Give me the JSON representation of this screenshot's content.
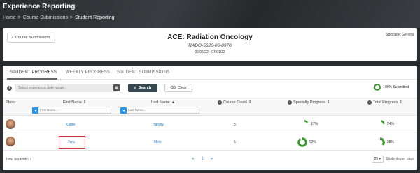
{
  "app": {
    "title": "Experience Reporting",
    "breadcrumb": [
      "Home",
      ">",
      "Course Submissions",
      ">",
      "Student Reporting"
    ]
  },
  "header": {
    "back_label": "Course Submissions",
    "title": "ACE: Radiation Oncology",
    "code": "RADO-5620-06-0970",
    "dates": "06/06/22 - 07/01/22",
    "specialty": "Specialty: General"
  },
  "tabs": [
    {
      "label": "STUDENT PROGRESS",
      "active": true
    },
    {
      "label": "WEEKLY PROGRESS",
      "active": false
    },
    {
      "label": "STUDENT SUBMISSIONS",
      "active": false
    }
  ],
  "toolbar": {
    "date_placeholder": "Select experience date range...",
    "search_label": "Search",
    "clear_label": "Clear",
    "submitted_label": "100% Submitted"
  },
  "columns": {
    "photo": "Photo",
    "first_name": "First Name",
    "last_name": "Last Name",
    "course_count": "Course Count",
    "specialty_progress": "Specialty Progress",
    "total_progress": "Total Progress",
    "first_name_filter": "First Name...",
    "last_name_filter": "Last Name..."
  },
  "rows": [
    {
      "first_name": "Karen",
      "last_name": "Harvey",
      "course_count": "5",
      "specialty_progress": "17%",
      "specialty_value": 0.17,
      "total_progress": "24%",
      "total_value": 0.24
    },
    {
      "first_name": "Tara",
      "last_name": "Mele",
      "course_count": "6",
      "specialty_progress": "92%",
      "specialty_value": 0.92,
      "total_progress": "38%",
      "total_value": 0.38
    }
  ],
  "footer": {
    "total": "Total Students: 2",
    "first": "«",
    "page": "1",
    "last": "»",
    "per_page_value": "25",
    "per_page_label": "Students per page"
  },
  "colors": {
    "progress_green": "#3a9a2d",
    "link_blue": "#1a73c8",
    "filter_blue": "#2196f3",
    "search_button": "#37474f",
    "highlight_red": "#d93636"
  }
}
